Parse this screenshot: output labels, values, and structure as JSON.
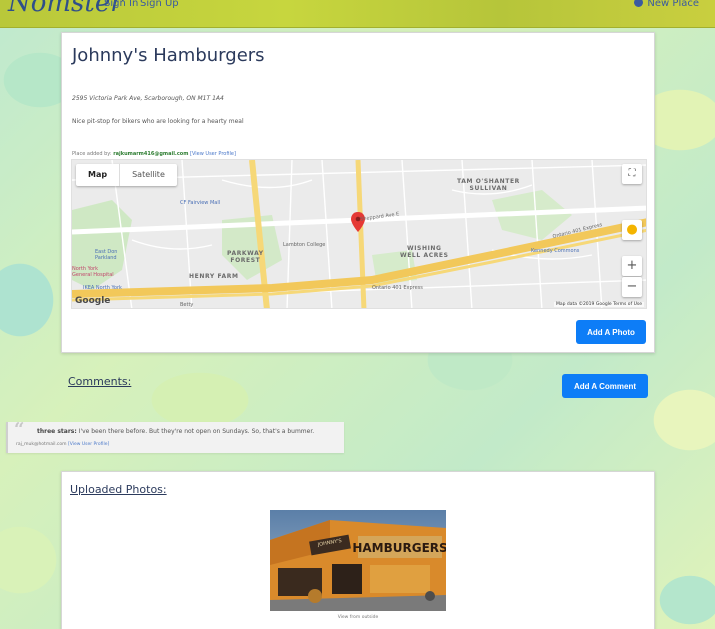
{
  "navbar": {
    "brand": "Nomster",
    "sign_in": "Sign In",
    "sign_up": "Sign Up",
    "new_place": "New Place",
    "color": "#c3d23c"
  },
  "place": {
    "title": "Johnny's Hamburgers",
    "address": "2595 Victoria Park Ave, Scarborough, ON M1T 1A4",
    "description": "Nice pit-stop for bikers who are looking for a hearty meal",
    "added_by_label": "Place added by:",
    "added_by_user": "rajkumarm416@gmail.com",
    "view_profile": "[View User Profile]",
    "add_photo_button": "Add A Photo"
  },
  "map": {
    "type_map": "Map",
    "type_satellite": "Satellite",
    "zoom_in": "+",
    "zoom_out": "−",
    "labels": {
      "tam_oshanter": "TAM O'SHANTER\nSULLIVAN",
      "parkway_forest": "PARKWAY\nFOREST",
      "henry_farm": "HENRY FARM",
      "wishing_well": "WISHING\nWELL ACRES"
    },
    "pois": {
      "fairview_mall": "CF Fairview Mall",
      "lambton_college": "Lambton College",
      "east_don": "East Don\nParkland",
      "north_york_hospital": "North York\nGeneral Hospital",
      "ikea": "IKEA North York",
      "kennedy_commons": "Kennedy Commons",
      "betty": "Betty",
      "ontario_401": "Ontario 401 Express",
      "ontario_401_b": "Ontario 401 Express",
      "sheppard": "Sheppard Ave E"
    },
    "footer": "Map data ©2019 Google   Terms of Use",
    "google": "Google"
  },
  "comments": {
    "heading": "Comments:",
    "add_button": "Add A Comment",
    "items": [
      {
        "rating": "three stars:",
        "text": "I've been there before. But they're not open on Sundays. So, that's a bummer.",
        "user": "raj_muk@hotmail.com",
        "view_profile": "[View User Profile]"
      }
    ]
  },
  "photos": {
    "heading": "Uploaded Photos:",
    "sign_text": "HAMBURGERS",
    "sign_text_top": "JOHNNY'S",
    "caption": "View from outside"
  }
}
